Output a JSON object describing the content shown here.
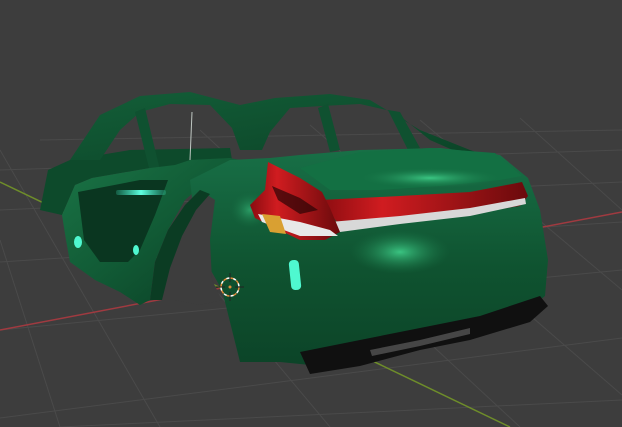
{
  "app": {
    "view": "3d-viewport",
    "shading": "material-preview"
  },
  "scene": {
    "object": "car-body-shell",
    "colors": {
      "background": "#3d3d3d",
      "grid_line": "#4a4a4a",
      "x_axis": "#a03a40",
      "y_axis": "#6e8d2a",
      "body_dark": "#0c3a22",
      "body_mid": "#14603a",
      "body_highlight": "#2fbf7f",
      "interior_glow": "#3ff0c8",
      "taillight_red": "#c41418",
      "taillight_white": "#e8e8e8",
      "indicator_amber": "#d9a032",
      "trim_black": "#101010",
      "cursor_orange": "#e08a3a"
    },
    "icons": {
      "origin": "3d-cursor-icon"
    }
  }
}
